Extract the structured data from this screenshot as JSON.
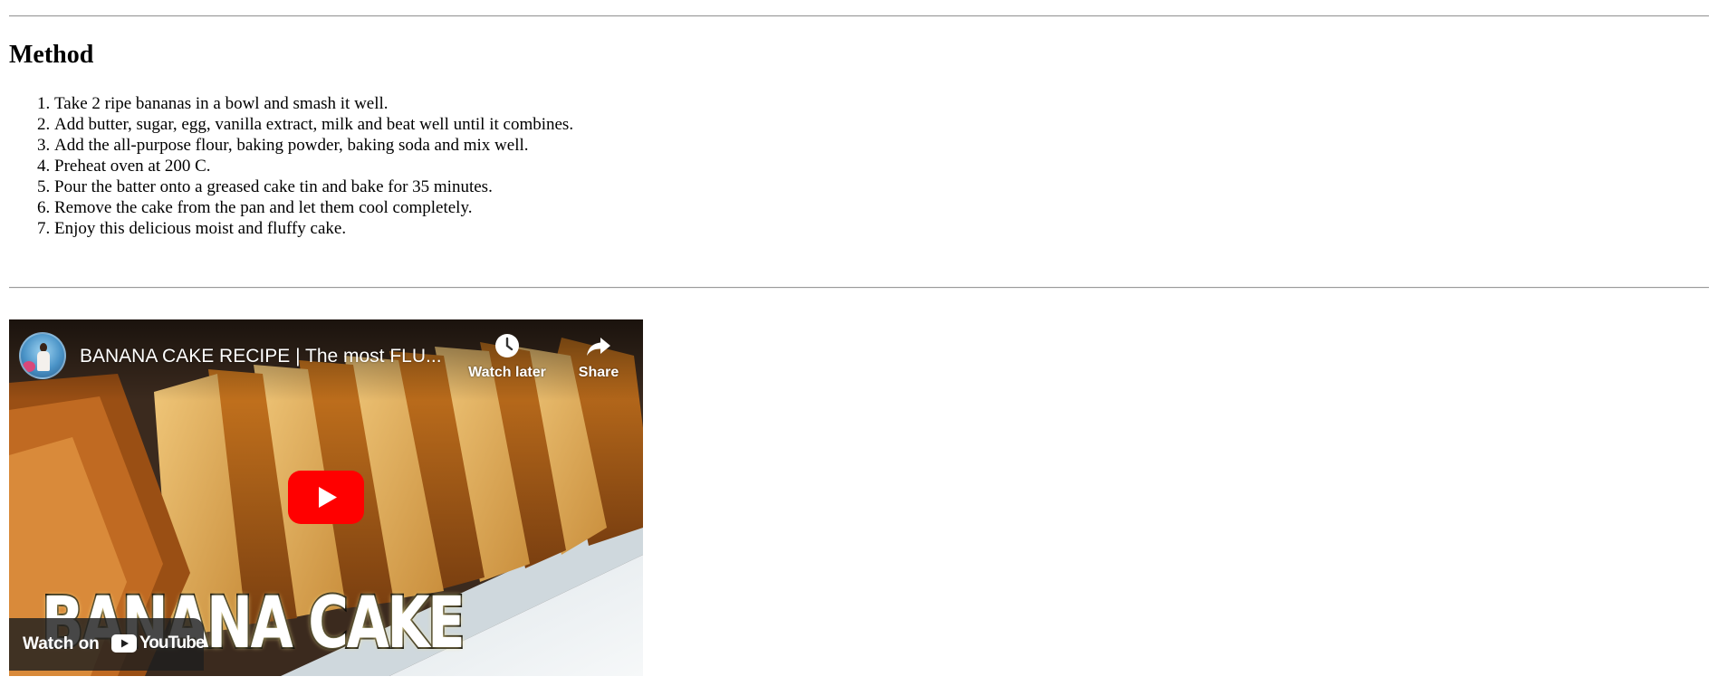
{
  "method": {
    "heading": "Method",
    "steps": [
      "Take 2 ripe bananas in a bowl and smash it well.",
      "Add butter, sugar, egg, vanilla extract, milk and beat well until it combines.",
      "Add the all-purpose flour, baking powder, baking soda and mix well.",
      "Preheat oven at 200 C.",
      "Pour the batter onto a greased cake tin and bake for 35 minutes.",
      "Remove the cake from the pan and let them cool completely.",
      "Enjoy this delicious moist and fluffy cake."
    ]
  },
  "video": {
    "title": "BANANA CAKE RECIPE | The most FLU...",
    "watch_later_label": "Watch later",
    "share_label": "Share",
    "thumbnail_text": "BANANA CAKE",
    "watch_on_label": "Watch on",
    "brand_label": "YouTube",
    "icons": {
      "channel": "channel-avatar",
      "watch_later": "clock-icon",
      "share": "share-arrow-icon",
      "play": "play-icon",
      "logo": "youtube-logo-icon"
    },
    "colors": {
      "play_red": "#ff0000",
      "bar_bg": "#1e1e1e"
    }
  }
}
